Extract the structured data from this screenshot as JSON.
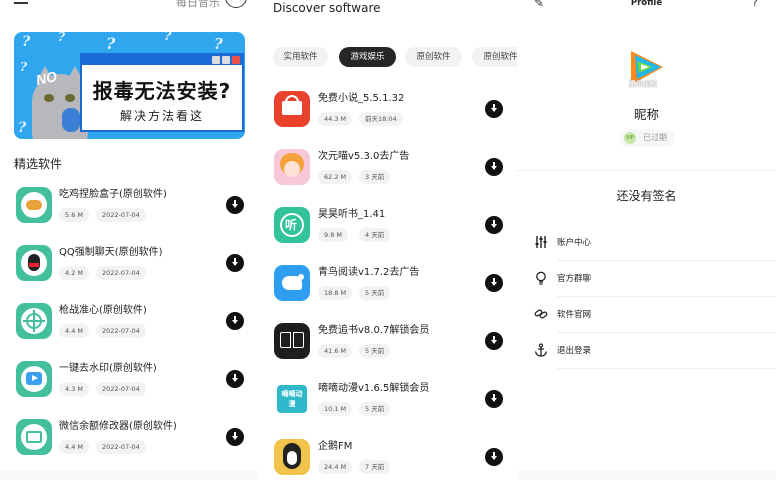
{
  "home": {
    "daily_music_label": "每日音乐",
    "banner": {
      "no_text": "NO",
      "title": "报毒无法安装?",
      "subtitle": "解决方法看这"
    },
    "section_title": "精选软件",
    "items": [
      {
        "name": "吃鸡捏脸盒子(原创软件)",
        "size": "5.6 M",
        "date": "2022-07-04",
        "icon": "chicken-icon"
      },
      {
        "name": "QQ强制聊天(原创软件)",
        "size": "4.2 M",
        "date": "2022-07-04",
        "icon": "qq-penguin-icon"
      },
      {
        "name": "枪战准心(原创软件)",
        "size": "4.4 M",
        "date": "2022-07-04",
        "icon": "crosshair-icon"
      },
      {
        "name": "一键去水印(原创软件)",
        "size": "4.3 M",
        "date": "2022-07-04",
        "icon": "video-play-icon"
      },
      {
        "name": "微信余额修改器(原创软件)",
        "size": "4.4 M",
        "date": "2022-07-04",
        "icon": "wallet-icon"
      }
    ]
  },
  "discover": {
    "title": "Discover software",
    "tabs": [
      "实用软件",
      "游戏娱乐",
      "原创软件",
      "原创软件"
    ],
    "active_tab": 1,
    "items": [
      {
        "name": "免费小说_5.5.1.32",
        "size": "44.3 M",
        "time": "前天18:04",
        "icon": "red-book-icon"
      },
      {
        "name": "次元喵v5.3.0去广告",
        "size": "62.2 M",
        "time": "3 天前",
        "icon": "anime-girl-icon"
      },
      {
        "name": "昊昊听书_1.41",
        "size": "9.8 M",
        "time": "4 天前",
        "icon": "listen-book-icon"
      },
      {
        "name": "青鸟阅读v1.7.2去广告",
        "size": "18.8 M",
        "time": "5 天前",
        "icon": "bird-icon"
      },
      {
        "name": "免费追书v8.0.7解锁会员",
        "size": "41.6 M",
        "time": "5 天前",
        "icon": "open-book-icon"
      },
      {
        "name": "嘀嘀动漫v1.6.5解锁会员",
        "size": "10.1 M",
        "time": "5 天前",
        "icon": "didi-anime-icon"
      },
      {
        "name": "企鹅FM",
        "size": "24.4 M",
        "time": "7 天前",
        "icon": "penguin-icon"
      }
    ],
    "tile_text": {
      "listen": "听",
      "didi": "嘀嘀动漫"
    }
  },
  "profile": {
    "title": "Profile",
    "avatar_caption": "腾讯视频",
    "nickname": "昵称",
    "vip_badge": "VIP",
    "vip_status": "已过期",
    "no_signature": "还没有签名",
    "menu": [
      {
        "label": "账户中心",
        "icon": "sliders-icon"
      },
      {
        "label": "官方群聊",
        "icon": "lightbulb-icon"
      },
      {
        "label": "软件官网",
        "icon": "link-icon"
      },
      {
        "label": "退出登录",
        "icon": "anchor-icon"
      }
    ]
  }
}
